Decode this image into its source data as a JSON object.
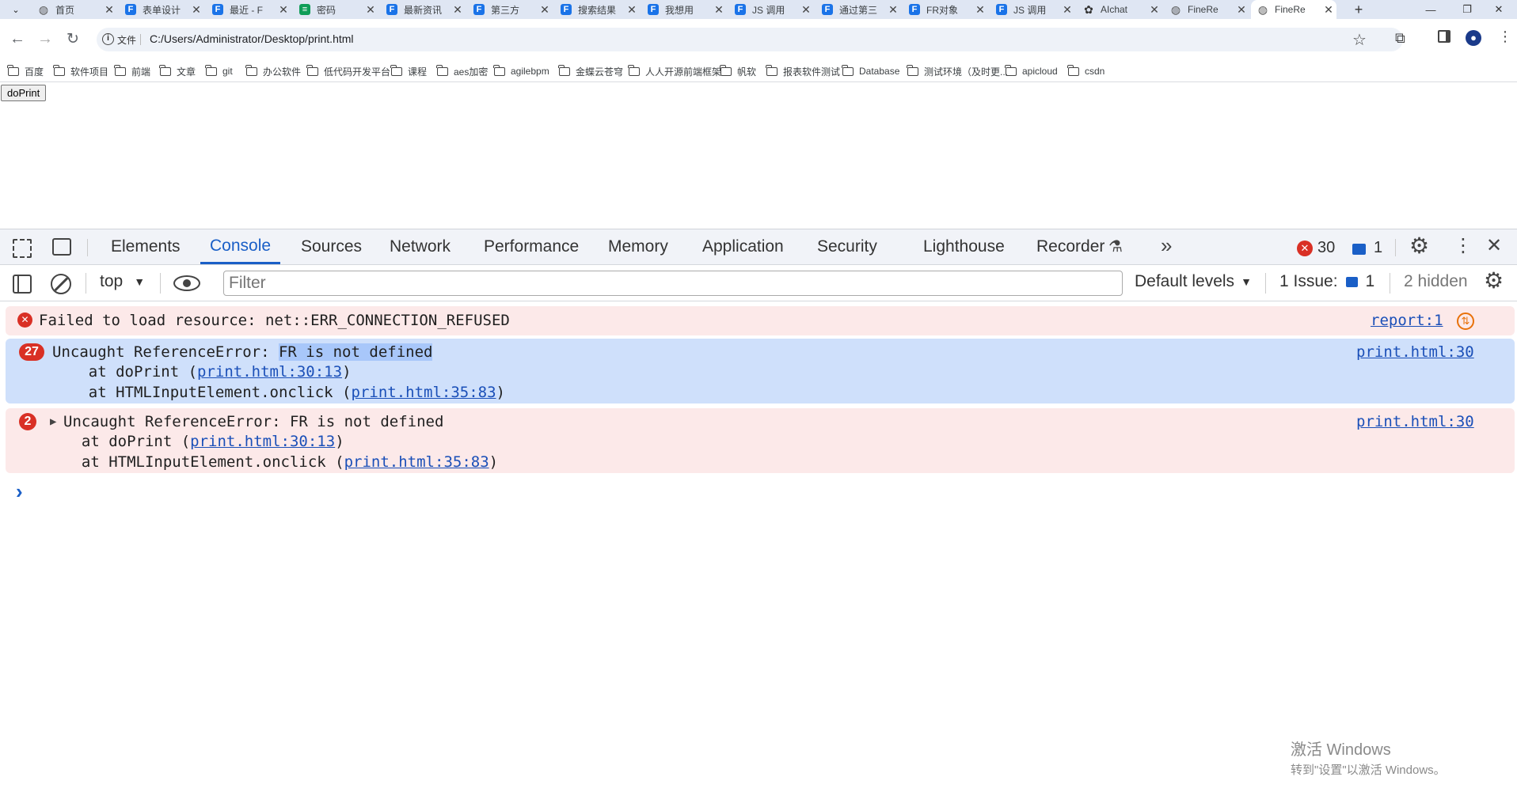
{
  "browser": {
    "tabs": [
      {
        "title": "首页",
        "icon": "globe-icon",
        "color": "#555555"
      },
      {
        "title": "表单设计",
        "icon": "fanruan-icon",
        "color": "#1a73e8"
      },
      {
        "title": "最近 - F",
        "icon": "fanruan-doc-icon",
        "color": "#1a73e8"
      },
      {
        "title": "密码",
        "icon": "sheet-icon",
        "color": "#0f9d58"
      },
      {
        "title": "最新资讯",
        "icon": "chart-icon",
        "color": "#1a73e8"
      },
      {
        "title": "第三方",
        "icon": "fanruan-icon",
        "color": "#1a73e8"
      },
      {
        "title": "搜索结果",
        "icon": "fanruan-icon",
        "color": "#1a73e8"
      },
      {
        "title": "我想用",
        "icon": "fanruan-icon",
        "color": "#1a73e8"
      },
      {
        "title": "JS 调用",
        "icon": "fanruan-icon",
        "color": "#1a73e8"
      },
      {
        "title": "通过第三",
        "icon": "fanruan-icon",
        "color": "#1a73e8"
      },
      {
        "title": "FR对象",
        "icon": "fanruan-icon",
        "color": "#1a73e8"
      },
      {
        "title": "JS 调用",
        "icon": "fanruan-icon",
        "color": "#1a73e8"
      },
      {
        "title": "AIchat",
        "icon": "openai-icon",
        "color": "#333333"
      },
      {
        "title": "FineRe",
        "icon": "globe-icon",
        "color": "#555555"
      },
      {
        "title": "FineRe",
        "icon": "globe-icon",
        "color": "#555555",
        "active": true
      }
    ],
    "new_tab": "+",
    "tab_close": "✕",
    "address": {
      "scheme_label": "文件",
      "url": "C:/Users/Administrator/Desktop/print.html"
    },
    "bookmarks": [
      "百度",
      "软件项目",
      "前端",
      "文章",
      "git",
      "办公软件",
      "低代码开发平台",
      "课程",
      "aes加密",
      "agilebpm",
      "金蝶云苍穹",
      "人人开源前端框架",
      "帆软",
      "报表软件测试",
      "Database",
      "测试环境（及时更...",
      "apicloud",
      "csdn"
    ]
  },
  "page": {
    "button_label": "doPrint"
  },
  "devtools": {
    "tabs": [
      "Elements",
      "Console",
      "Sources",
      "Network",
      "Performance",
      "Memory",
      "Application",
      "Security",
      "Lighthouse",
      "Recorder"
    ],
    "active_tab": "Console",
    "error_count": "30",
    "message_count": "1",
    "context": "top",
    "filter_placeholder": "Filter",
    "levels": "Default levels",
    "issues_label": "1 Issue:",
    "issues_count": "1",
    "hidden": "2 hidden",
    "messages": [
      {
        "text": "Failed to load resource: net::ERR_CONNECTION_REFUSED",
        "source": "report:1"
      },
      {
        "count": "27",
        "prefix": "Uncaught ReferenceError: ",
        "highlight": "FR is not defined",
        "source": "print.html:30",
        "stack": [
          {
            "pre": "    at doPrint (",
            "link": "print.html:30:13",
            "post": ")"
          },
          {
            "pre": "    at HTMLInputElement.onclick (",
            "link": "print.html:35:83",
            "post": ")"
          }
        ]
      },
      {
        "count": "2",
        "text": "Uncaught ReferenceError: FR is not defined",
        "source": "print.html:30",
        "stack": [
          {
            "pre": "  at doPrint (",
            "link": "print.html:30:13",
            "post": ")"
          },
          {
            "pre": "  at HTMLInputElement.onclick (",
            "link": "print.html:35:83",
            "post": ")"
          }
        ]
      }
    ],
    "prompt": "›"
  },
  "watermark": {
    "title": "激活 Windows",
    "subtitle": "转到\"设置\"以激活 Windows。"
  },
  "colors": {
    "accent": "#1a5fc7",
    "error": "#d93025",
    "error_bg": "#fce9e9",
    "selected_bg": "#cfe0fb"
  }
}
